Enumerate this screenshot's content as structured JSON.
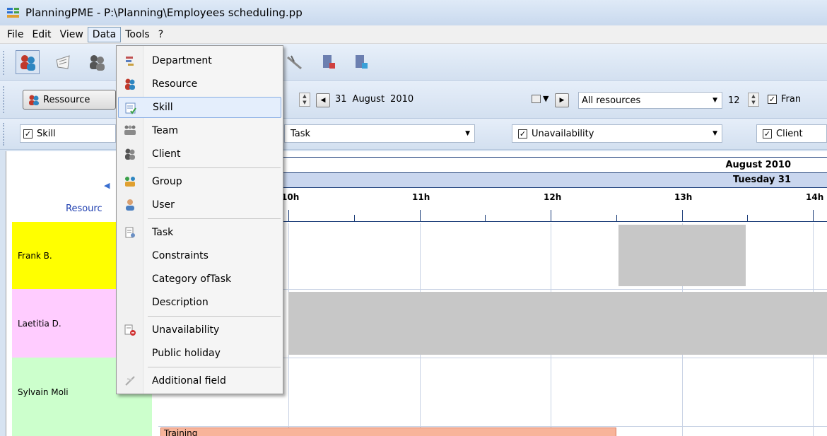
{
  "window": {
    "title": "PlanningPME - P:\\Planning\\Employees scheduling.pp"
  },
  "menubar": {
    "items": [
      "File",
      "Edit",
      "View",
      "Data",
      "Tools",
      "?"
    ]
  },
  "toolbar": {
    "view_button_label": "Ressource",
    "date_day": "31",
    "date_month": "August",
    "date_year": "2010",
    "resource_filter": "All resources",
    "count_value": "12",
    "fr_label": "Fran",
    "filters": {
      "skill": "Skill",
      "task": "Task",
      "unavailability": "Unavailability",
      "client": "Client"
    }
  },
  "schedule": {
    "month_label": "August 2010",
    "day_label": "Tuesday 31",
    "hours": [
      "10h",
      "11h",
      "12h",
      "13h",
      "14h"
    ],
    "resource_header": "Resourc",
    "resources": [
      {
        "name": "Frank B.",
        "color": "#ffff00"
      },
      {
        "name": "Laetitia D.",
        "color": "#ffccff"
      },
      {
        "name": "Sylvain Moli",
        "color": "#ccffcc"
      },
      {
        "name": "",
        "color": "#ccffcc"
      }
    ],
    "task_label": "Training"
  },
  "data_menu": {
    "items": [
      {
        "label": "Department",
        "icon": "department-icon"
      },
      {
        "label": "Resource",
        "icon": "resource-icon"
      },
      {
        "label": "Skill",
        "icon": "skill-icon"
      },
      {
        "label": "Team",
        "icon": "team-icon"
      },
      {
        "label": "Client",
        "icon": "client-icon"
      },
      {
        "label": "Group",
        "icon": "group-icon"
      },
      {
        "label": "User",
        "icon": "user-icon"
      },
      {
        "label": "Task",
        "icon": "task-icon"
      },
      {
        "label": "Constraints",
        "icon": ""
      },
      {
        "label": "Category ofTask",
        "icon": ""
      },
      {
        "label": "Description",
        "icon": ""
      },
      {
        "label": "Unavailability",
        "icon": "unavailability-icon"
      },
      {
        "label": "Public holiday",
        "icon": ""
      },
      {
        "label": "Additional field",
        "icon": "additional-field-icon"
      }
    ]
  }
}
